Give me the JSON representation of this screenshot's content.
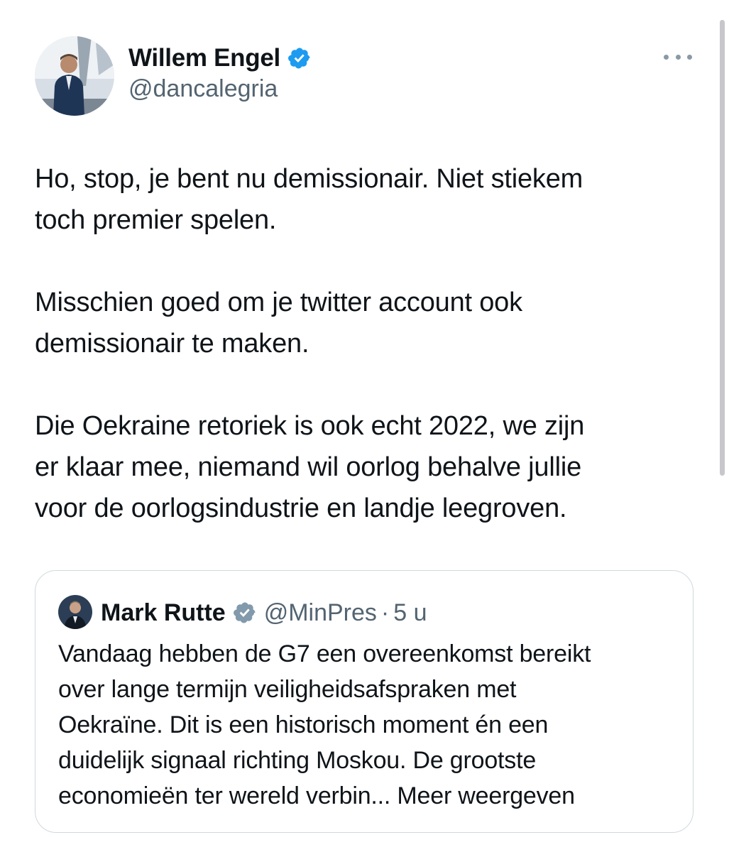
{
  "author": {
    "name": "Willem Engel",
    "handle": "@dancalegria",
    "verified_color": "#1d9bf0"
  },
  "tweet": {
    "paragraphs": [
      "Ho, stop, je bent nu demissionair. Niet stiekem\ntoch premier spelen.",
      "Misschien goed om je twitter account ook\ndemissionair te maken.",
      "Die Oekraine retoriek is ook echt 2022, we zijn\ner klaar mee, niemand wil oorlog behalve jullie\nvoor de oorlogsindustrie en landje leegroven."
    ]
  },
  "quoted": {
    "name": "Mark Rutte",
    "handle": "@MinPres",
    "separator": "·",
    "time": "5 u",
    "verified_color": "#829aab",
    "text": "Vandaag hebben de G7 een overeenkomst bereikt\nover lange termijn veiligheidsafspraken met\nOekraïne. Dit is een historisch moment én een\nduidelijk signaal richting Moskou. De grootste\neconomieën ter wereld verbin... Meer weergeven"
  },
  "icons": {
    "more": "more-horizontal-icon",
    "verified": "verified-badge-icon"
  }
}
